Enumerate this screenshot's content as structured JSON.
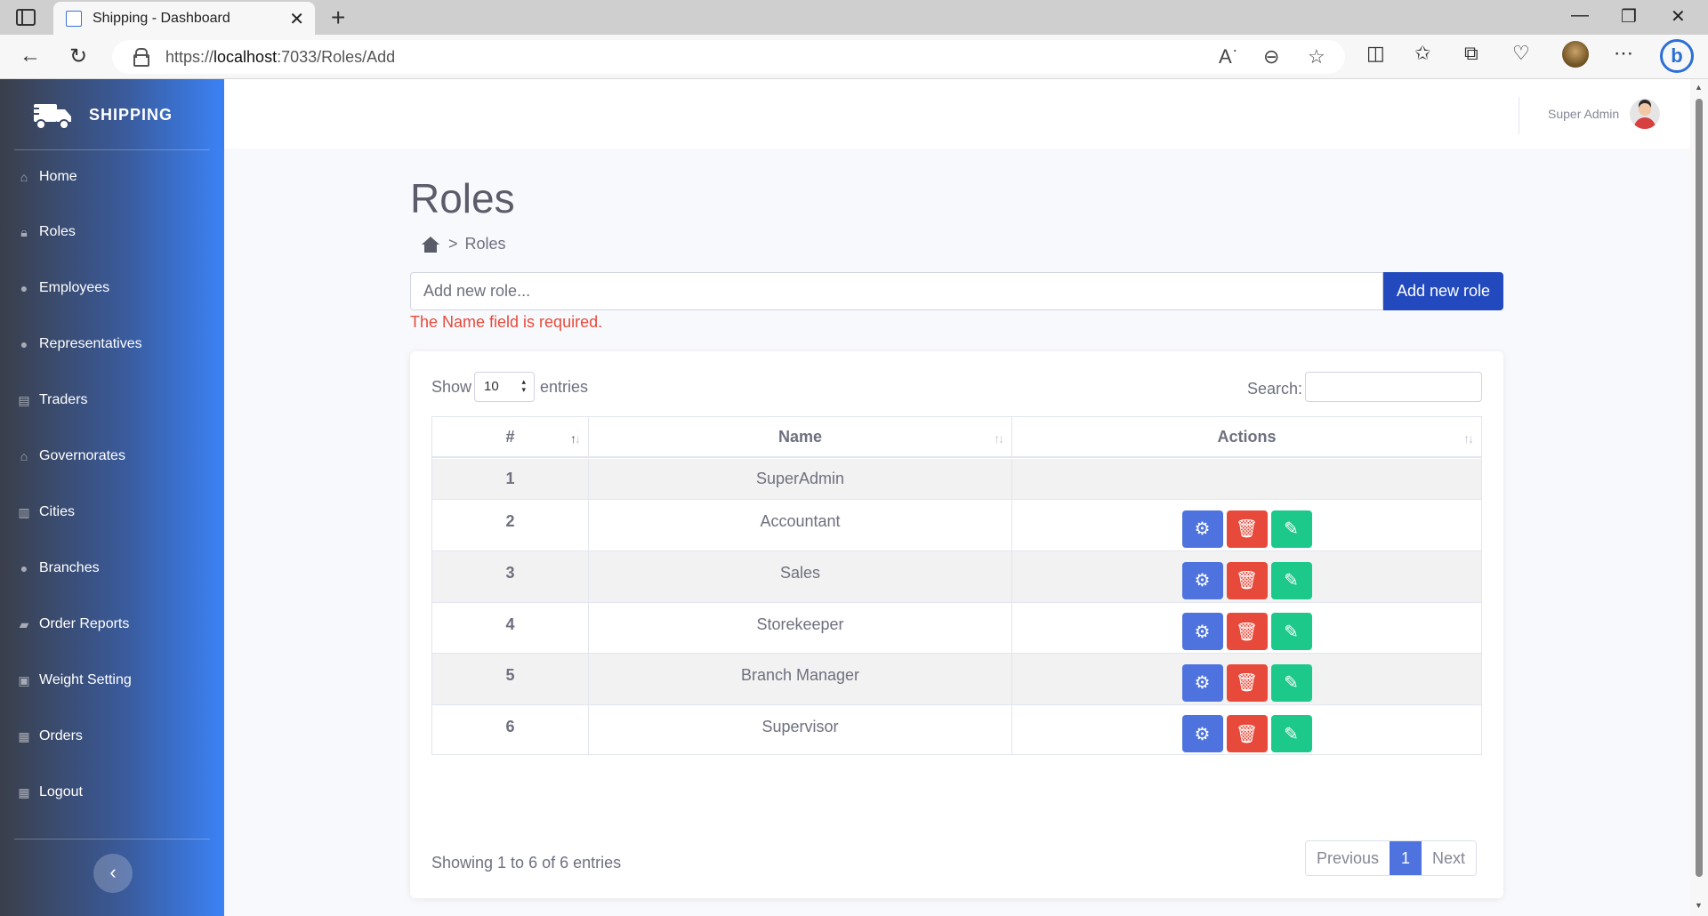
{
  "browser": {
    "tab_title": "Shipping - Dashboard",
    "url_scheme": "https://",
    "url_host": "localhost",
    "url_path": ":7033/Roles/Add"
  },
  "brand": {
    "name": "SHIPPING"
  },
  "sidebar": {
    "items": [
      {
        "label": "Home",
        "icon": "home-icon"
      },
      {
        "label": "Roles",
        "icon": "lock-icon"
      },
      {
        "label": "Employees",
        "icon": "user-icon"
      },
      {
        "label": "Representatives",
        "icon": "user-icon"
      },
      {
        "label": "Traders",
        "icon": "store-icon"
      },
      {
        "label": "Governorates",
        "icon": "landmark-icon"
      },
      {
        "label": "Cities",
        "icon": "city-icon"
      },
      {
        "label": "Branches",
        "icon": "map-pin-icon"
      },
      {
        "label": "Order Reports",
        "icon": "truck-icon"
      },
      {
        "label": "Weight Setting",
        "icon": "weight-icon"
      },
      {
        "label": "Orders",
        "icon": "boxes-icon"
      },
      {
        "label": "Logout",
        "icon": "table-icon"
      }
    ]
  },
  "header": {
    "user_name": "Super Admin"
  },
  "page": {
    "title": "Roles",
    "breadcrumb_current": "Roles",
    "breadcrumb_sep": ">",
    "input_placeholder": "Add new role...",
    "add_button": "Add new role",
    "error": "The Name field is required."
  },
  "table": {
    "show_label": "Show",
    "page_size": "10",
    "entries_label": "entries",
    "search_label": "Search:",
    "columns": [
      "#",
      "Name",
      "Actions"
    ],
    "rows": [
      {
        "num": "1",
        "name": "SuperAdmin",
        "actions": false
      },
      {
        "num": "2",
        "name": "Accountant",
        "actions": true
      },
      {
        "num": "3",
        "name": "Sales",
        "actions": true
      },
      {
        "num": "4",
        "name": "Storekeeper",
        "actions": true
      },
      {
        "num": "5",
        "name": "Branch Manager",
        "actions": true
      },
      {
        "num": "6",
        "name": "Supervisor",
        "actions": true
      }
    ],
    "info": "Showing 1 to 6 of 6 entries",
    "pager": {
      "previous": "Previous",
      "current": "1",
      "next": "Next"
    }
  },
  "colors": {
    "primary": "#224abe",
    "settings": "#4e73df",
    "delete": "#e74a3b",
    "edit": "#1cc88a",
    "error": "#e74a3b"
  }
}
